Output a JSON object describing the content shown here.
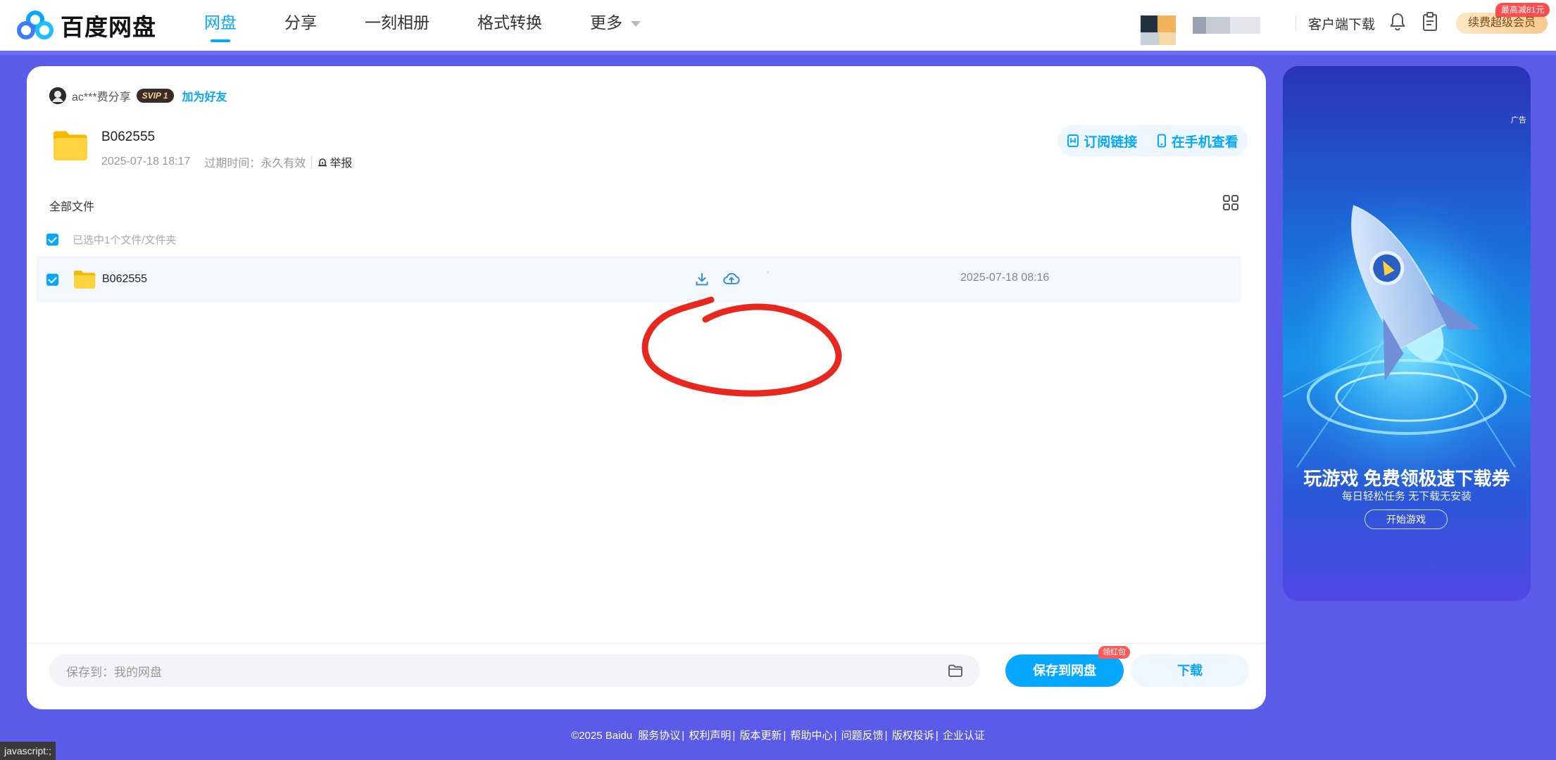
{
  "app": {
    "brand": "百度网盘"
  },
  "nav": {
    "items": [
      "网盘",
      "分享",
      "一刻相册",
      "格式转换",
      "更多"
    ],
    "active_index": 0
  },
  "header_right": {
    "client_download": "客户端下载",
    "vip_button": "续费超级会员",
    "vip_badge": "最高减81元"
  },
  "share": {
    "sharer_name": "ac***费分享",
    "badge": "SVIP 1",
    "add_friend": "加为好友",
    "title": "B062555",
    "created": "2025-07-18 18:17",
    "expire_label": "过期时间：永久有效",
    "report": "举报",
    "subscribe_link": "订阅链接",
    "view_on_phone": "在手机查看"
  },
  "file_list": {
    "breadcrumb": "全部文件",
    "selection_text": "已选中1个文件/文件夹",
    "rows": [
      {
        "name": "B062555",
        "modified": "2025-07-18 08:16",
        "selected": true
      }
    ]
  },
  "bottom_bar": {
    "save_path_label": "保存到：我的网盘",
    "save_button": "保存到网盘",
    "save_badge": "领红包",
    "download_button": "下载"
  },
  "ad": {
    "corner": "广告",
    "title": "玩游戏 免费领极速下载券",
    "subtitle": "每日轻松任务 无下载无安装",
    "button": "开始游戏"
  },
  "footer": {
    "copyright": "©2025 Baidu",
    "links": [
      "服务协议",
      "权利声明",
      "版本更新",
      "帮助中心",
      "问题反馈",
      "版权投诉",
      "企业认证"
    ]
  },
  "status_bar": {
    "text": "javascript:;"
  },
  "colors": {
    "accent": "#06a7ff",
    "page_bg": "#5a5be8",
    "annotation": "#e8281e"
  }
}
